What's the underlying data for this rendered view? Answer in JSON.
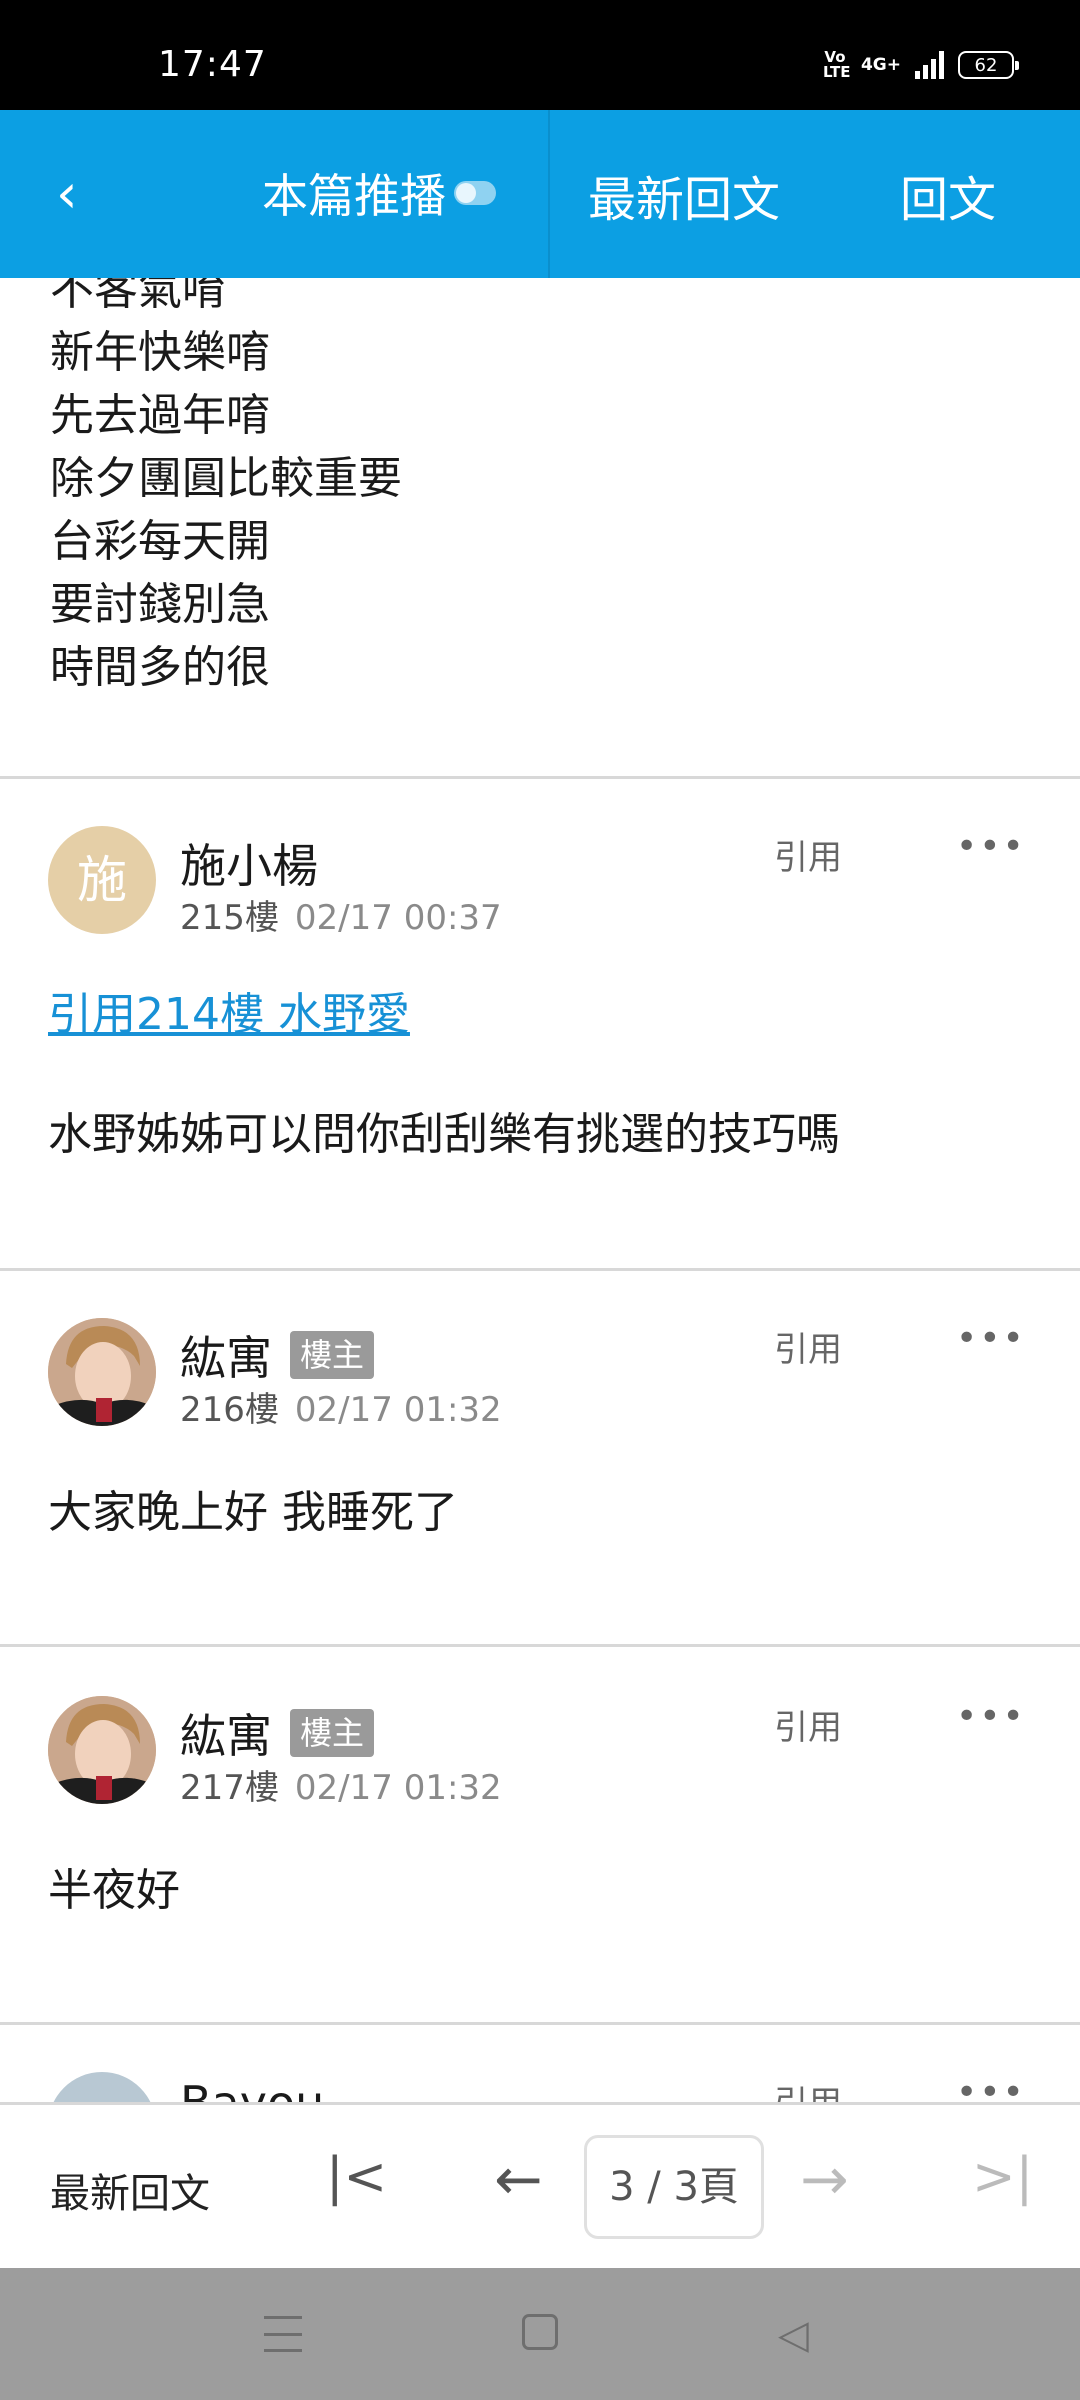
{
  "status": {
    "time": "17:47",
    "volte": "Vo LTE",
    "network": "4G+",
    "battery": "62"
  },
  "header": {
    "back_icon": "chevron-left-icon",
    "push_label": "本篇推播",
    "latest_label": "最新回文",
    "reply_label": "回文"
  },
  "prev_post_lines": [
    "不客氣唷",
    "新年快樂唷",
    "先去過年唷",
    "除夕團圓比較重要",
    "台彩每天開",
    "要討錢別急",
    "時間多的很"
  ],
  "posts": [
    {
      "avatar_text": "施",
      "author": "施小楊",
      "floor": "215樓",
      "time": "02/17 00:37",
      "quote_label": "引用",
      "quote_link": "引用214樓 水野愛",
      "body": "水野姊姊可以問你刮刮樂有挑選的技巧嗎"
    },
    {
      "author": "紘寓",
      "badge": "樓主",
      "floor": "216樓",
      "time": "02/17 01:32",
      "quote_label": "引用",
      "body": "大家晚上好 我睡死了"
    },
    {
      "author": "紘寓",
      "badge": "樓主",
      "floor": "217樓",
      "time": "02/17 01:32",
      "quote_label": "引用",
      "body": "半夜好"
    },
    {
      "author": "Bayou",
      "quote_label": "引用"
    }
  ],
  "more_icon": "•••",
  "footer": {
    "latest_label": "最新回文",
    "first_icon": "|<",
    "prev_icon": "←",
    "page_indicator": "3 / 3頁",
    "next_icon": "→",
    "last_icon": ">|"
  },
  "nav": {
    "menu_icon": "menu-icon",
    "home_icon": "home-icon",
    "back_icon": "back-triangle-icon"
  },
  "colors": {
    "header_bg": "#0c9fe3",
    "link": "#1791d6",
    "badge_bg": "#9a9a9a"
  }
}
